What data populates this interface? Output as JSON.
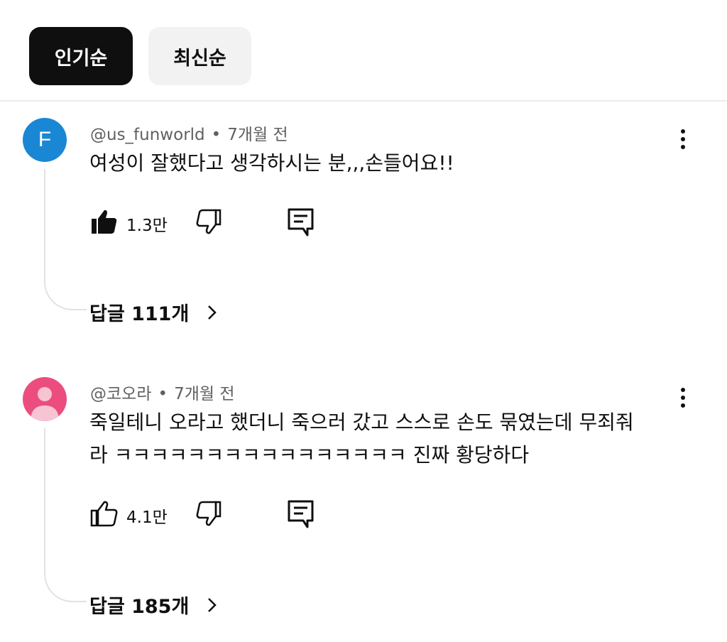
{
  "sort_chips": {
    "popular": "인기순",
    "newest": "최신순"
  },
  "comments": [
    {
      "author": "@us_funworld",
      "time": "7개월 전",
      "avatar_letter": "F",
      "text_lines": [
        "여성이 잘했다고 생각하시는 분,,,손들어요!!"
      ],
      "likes": "1.3만",
      "liked": true,
      "replies": "답글 111개"
    },
    {
      "author": "@코오라",
      "time": "7개월 전",
      "avatar_letter": "",
      "text_lines": [
        "죽일테니 오라고 했더니  죽으러 갔고 스스로 손도 묶였는데 무죄줘",
        "라 ㅋㅋㅋㅋㅋㅋㅋㅋㅋㅋㅋㅋㅋㅋㅋㅋ 진짜 황당하다"
      ],
      "likes": "4.1만",
      "liked": false,
      "replies": "답글 185개"
    }
  ],
  "meta_separator": "•",
  "colors": {
    "chip_active": "#0f0f0f",
    "chip_inactive": "#f2f2f2",
    "avatar1": "#1a87d4",
    "avatar2": "#ec4d7f"
  },
  "icons": [
    "like-icon",
    "dislike-icon",
    "reply-icon",
    "more-icon",
    "chevron-right-icon",
    "user-icon"
  ]
}
